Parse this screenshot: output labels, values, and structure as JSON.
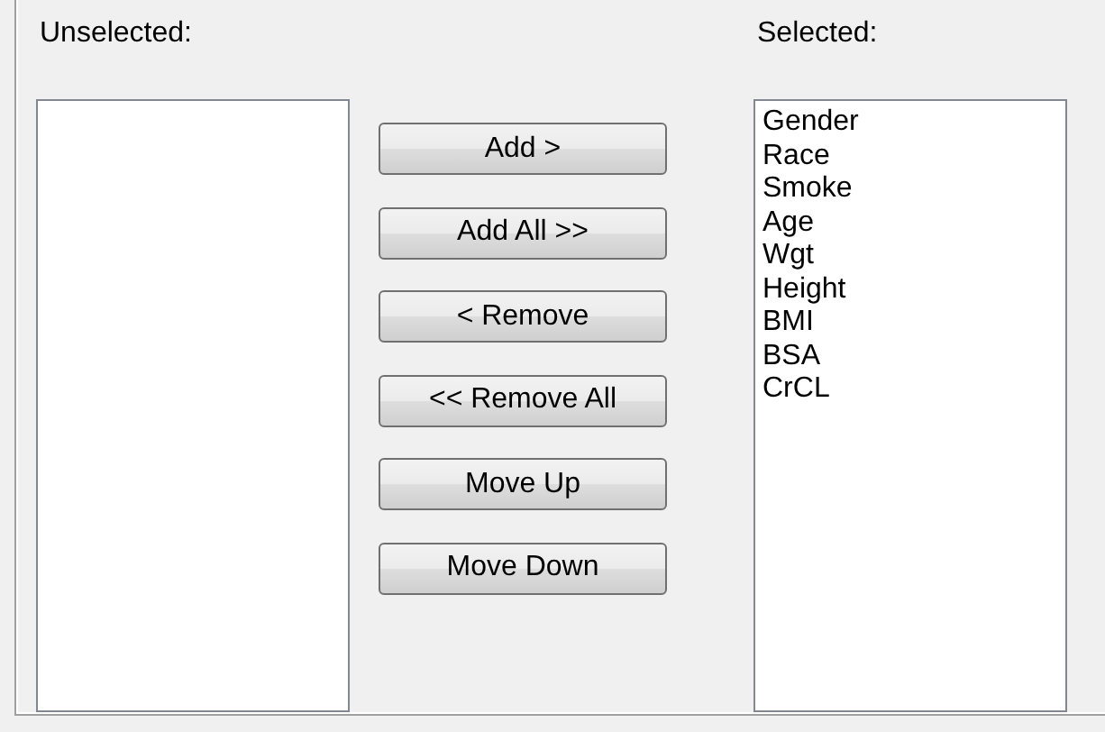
{
  "unselected_list": {
    "label": "Unselected:"
  },
  "buttons": [
    "Add >",
    "Add All >>",
    "< Remove",
    "<< Remove All",
    "Move Up",
    "Move Down"
  ],
  "selected_list": {
    "label": "Selected:",
    "items": [
      "Gender",
      "Race",
      "Smoke",
      "Age",
      "Wgt",
      "Height",
      "BMI",
      "BSA",
      "CrCL"
    ]
  }
}
